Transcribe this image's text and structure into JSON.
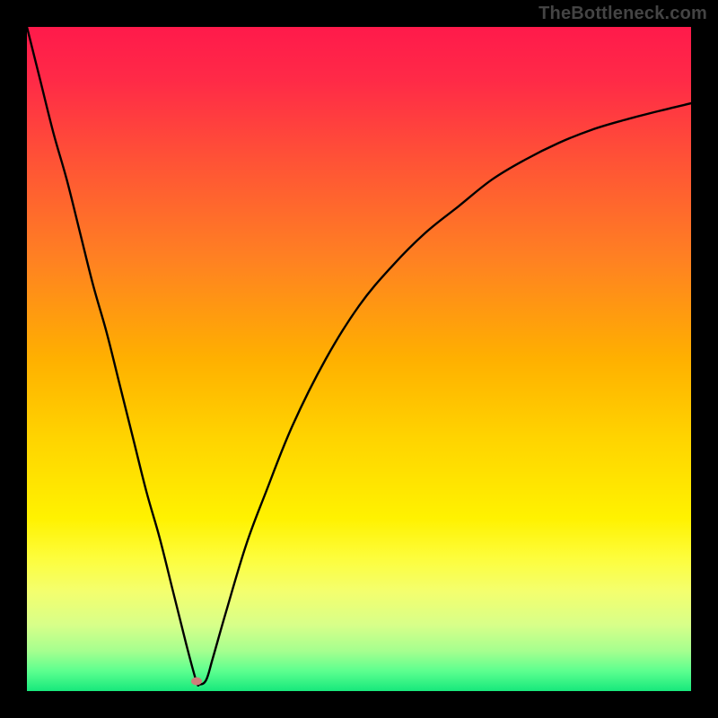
{
  "watermark": "TheBottleneck.com",
  "colors": {
    "frame_bg": "#000000",
    "curve": "#000000",
    "marker": "#cf7d7a",
    "gradient_stops": [
      {
        "offset": 0.0,
        "color": "#ff1a4b"
      },
      {
        "offset": 0.08,
        "color": "#ff2a47"
      },
      {
        "offset": 0.2,
        "color": "#ff5236"
      },
      {
        "offset": 0.35,
        "color": "#ff8122"
      },
      {
        "offset": 0.5,
        "color": "#ffb000"
      },
      {
        "offset": 0.62,
        "color": "#ffd400"
      },
      {
        "offset": 0.74,
        "color": "#fff200"
      },
      {
        "offset": 0.8,
        "color": "#fdfd3c"
      },
      {
        "offset": 0.85,
        "color": "#f4ff6e"
      },
      {
        "offset": 0.9,
        "color": "#d8ff89"
      },
      {
        "offset": 0.94,
        "color": "#a5ff8f"
      },
      {
        "offset": 0.97,
        "color": "#5cff8f"
      },
      {
        "offset": 1.0,
        "color": "#17e87c"
      }
    ]
  },
  "chart_data": {
    "type": "line",
    "title": "",
    "xlabel": "",
    "ylabel": "",
    "xlim": [
      0,
      100
    ],
    "ylim": [
      0,
      100
    ],
    "grid": false,
    "legend": false,
    "series": [
      {
        "name": "bottleneck-curve",
        "x": [
          0,
          2,
          4,
          6,
          8,
          10,
          12,
          14,
          16,
          18,
          20,
          22,
          24,
          25.5,
          26,
          27,
          28,
          30,
          33,
          36,
          40,
          45,
          50,
          55,
          60,
          65,
          70,
          75,
          80,
          85,
          90,
          95,
          100
        ],
        "y": [
          100,
          92,
          84,
          77,
          69,
          61,
          54,
          46,
          38,
          30,
          23,
          15,
          7,
          1.5,
          1.0,
          1.7,
          5,
          12,
          22,
          30,
          40,
          50,
          58,
          64,
          69,
          73,
          77,
          80,
          82.5,
          84.5,
          86,
          87.3,
          88.5
        ]
      }
    ],
    "markers": [
      {
        "name": "optimum-point",
        "x": 25.5,
        "y": 1.5
      }
    ],
    "notes": "Values are estimated from pixel positions relative to the inner plot area (0–100 normalized on both axes, origin at bottom-left). The curve descends steeply from top-left, reaches a minimum near x≈25.5, then rises with decreasing slope toward the upper right."
  }
}
